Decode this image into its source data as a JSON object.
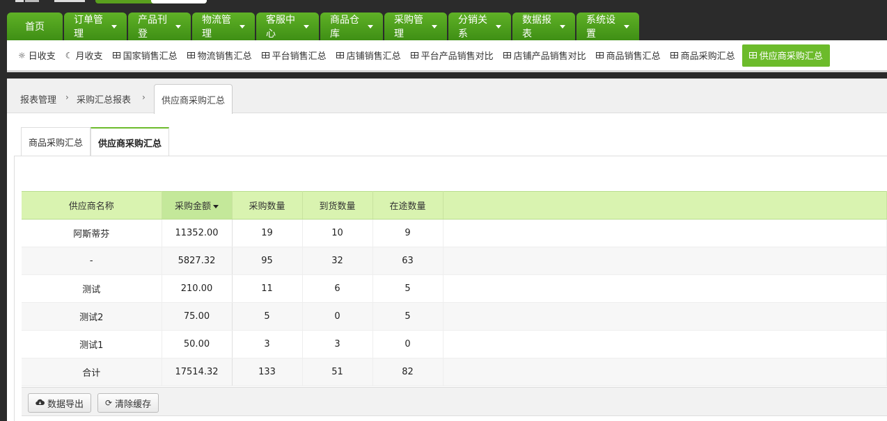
{
  "main_nav": [
    {
      "label": "首页",
      "has_caret": false,
      "width": 80
    },
    {
      "label": "订单管理",
      "has_caret": true,
      "width": 90
    },
    {
      "label": "产品刊登",
      "has_caret": true,
      "width": 90
    },
    {
      "label": "物流管理",
      "has_caret": true,
      "width": 90
    },
    {
      "label": "客服中心",
      "has_caret": true,
      "width": 90
    },
    {
      "label": "商品仓库",
      "has_caret": true,
      "width": 90
    },
    {
      "label": "采购管理",
      "has_caret": true,
      "width": 90
    },
    {
      "label": "分销关系",
      "has_caret": true,
      "width": 90
    },
    {
      "label": "数据报表",
      "has_caret": true,
      "width": 90
    },
    {
      "label": "系统设置",
      "has_caret": true,
      "width": 90
    }
  ],
  "sub_nav": {
    "items": [
      {
        "label": "日收支",
        "icon": "sun-icon"
      },
      {
        "label": "月收支",
        "icon": "moon-icon"
      },
      {
        "label": "国家销售汇总",
        "icon": "table-icon"
      },
      {
        "label": "物流销售汇总",
        "icon": "table-icon"
      },
      {
        "label": "平台销售汇总",
        "icon": "table-icon"
      },
      {
        "label": "店铺销售汇总",
        "icon": "table-icon"
      },
      {
        "label": "平台产品销售对比",
        "icon": "table-icon"
      },
      {
        "label": "店铺产品销售对比",
        "icon": "table-icon"
      },
      {
        "label": "商品销售汇总",
        "icon": "table-icon"
      },
      {
        "label": "商品采购汇总",
        "icon": "table-icon"
      },
      {
        "label": "供应商采购汇总",
        "icon": "table-icon",
        "active": true
      }
    ]
  },
  "breadcrumb": {
    "level1": "报表管理",
    "level2": "采购汇总报表",
    "current": "供应商采购汇总"
  },
  "tabs": [
    {
      "label": "商品采购汇总",
      "active": false
    },
    {
      "label": "供应商采购汇总",
      "active": true
    }
  ],
  "grid": {
    "columns": [
      "供应商名称",
      "采购金额",
      "采购数量",
      "到货数量",
      "在途数量"
    ],
    "sorted_column": "采购金额",
    "rows": [
      [
        "阿斯蒂芬",
        "11352.00",
        "19",
        "10",
        "9"
      ],
      [
        "-",
        "5827.32",
        "95",
        "32",
        "63"
      ],
      [
        "测试",
        "210.00",
        "11",
        "6",
        "5"
      ],
      [
        "测试2",
        "75.00",
        "5",
        "0",
        "5"
      ],
      [
        "测试1",
        "50.00",
        "3",
        "3",
        "0"
      ],
      [
        "合计",
        "17514.32",
        "133",
        "51",
        "82"
      ]
    ]
  },
  "footer": {
    "export_label": "数据导出",
    "clear_cache_label": "清除缓存"
  },
  "colors": {
    "nav_green": "#4fa01d",
    "active_green": "#6cbb2b",
    "header_bg": "#d9f3b0"
  }
}
